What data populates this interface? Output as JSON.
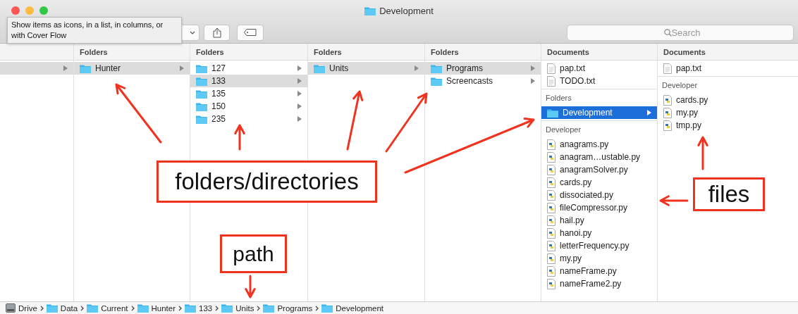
{
  "window": {
    "title": "Development"
  },
  "tooltip": "Show items as icons, in a list, in columns, or with Cover Flow",
  "search": {
    "placeholder": "Search"
  },
  "columns": [
    {
      "sections": [
        {
          "items": [
            {
              "kind": "folder",
              "selected": true
            }
          ]
        }
      ]
    },
    {
      "header": "Folders",
      "sections": [
        {
          "items": [
            {
              "kind": "folder",
              "name": "Hunter",
              "selected": true
            }
          ]
        }
      ]
    },
    {
      "header": "Folders",
      "sections": [
        {
          "items": [
            {
              "kind": "folder",
              "name": "127",
              "selected": false
            },
            {
              "kind": "folder",
              "name": "133",
              "selected": true
            },
            {
              "kind": "folder",
              "name": "135",
              "selected": false
            },
            {
              "kind": "folder",
              "name": "150",
              "selected": false
            },
            {
              "kind": "folder",
              "name": "235",
              "selected": false
            }
          ]
        }
      ]
    },
    {
      "header": "Folders",
      "sections": [
        {
          "items": [
            {
              "kind": "folder",
              "name": "Units",
              "selected": true
            }
          ]
        }
      ]
    },
    {
      "header": "Folders",
      "sections": [
        {
          "items": [
            {
              "kind": "folder",
              "name": "Programs",
              "selected": true
            },
            {
              "kind": "folder",
              "name": "Screencasts",
              "selected": false
            }
          ]
        }
      ]
    },
    {
      "header": "Documents",
      "active": true,
      "sections": [
        {
          "items": [
            {
              "kind": "text",
              "name": "pap.txt",
              "selected": false
            },
            {
              "kind": "text",
              "name": "TODO.txt",
              "selected": false
            }
          ]
        },
        {
          "heading": "Folders",
          "items": [
            {
              "kind": "folder",
              "name": "Development",
              "selected": true
            }
          ]
        },
        {
          "heading": "Developer",
          "items": [
            {
              "kind": "python",
              "name": "anagrams.py",
              "selected": false
            },
            {
              "kind": "python",
              "name": "anagram…ustable.py",
              "selected": false
            },
            {
              "kind": "python",
              "name": "anagramSolver.py",
              "selected": false
            },
            {
              "kind": "python",
              "name": "cards.py",
              "selected": false
            },
            {
              "kind": "python",
              "name": "dissociated.py",
              "selected": false
            },
            {
              "kind": "python",
              "name": "fileCompressor.py",
              "selected": false
            },
            {
              "kind": "python",
              "name": "hail.py",
              "selected": false
            },
            {
              "kind": "python",
              "name": "hanoi.py",
              "selected": false
            },
            {
              "kind": "python",
              "name": "letterFrequency.py",
              "selected": false
            },
            {
              "kind": "python",
              "name": "my.py",
              "selected": false
            },
            {
              "kind": "python",
              "name": "nameFrame.py",
              "selected": false
            },
            {
              "kind": "python",
              "name": "nameFrame2.py",
              "selected": false
            }
          ]
        }
      ]
    },
    {
      "header": "Documents",
      "sections": [
        {
          "items": [
            {
              "kind": "text",
              "name": "pap.txt",
              "selected": false
            }
          ]
        },
        {
          "heading": "Developer",
          "items": [
            {
              "kind": "python",
              "name": "cards.py",
              "selected": false
            },
            {
              "kind": "python",
              "name": "my.py",
              "selected": false
            },
            {
              "kind": "python",
              "name": "tmp.py",
              "selected": false
            }
          ]
        }
      ]
    }
  ],
  "path_bar": [
    {
      "kind": "drive",
      "name": "Drive"
    },
    {
      "kind": "folder",
      "name": "Data"
    },
    {
      "kind": "folder",
      "name": "Current"
    },
    {
      "kind": "folder",
      "name": "Hunter"
    },
    {
      "kind": "folder",
      "name": "133"
    },
    {
      "kind": "folder",
      "name": "Units"
    },
    {
      "kind": "folder",
      "name": "Programs"
    },
    {
      "kind": "folder",
      "name": "Development"
    }
  ],
  "annotations": [
    {
      "text": "folders/directories"
    },
    {
      "text": "files"
    },
    {
      "text": "path"
    }
  ]
}
